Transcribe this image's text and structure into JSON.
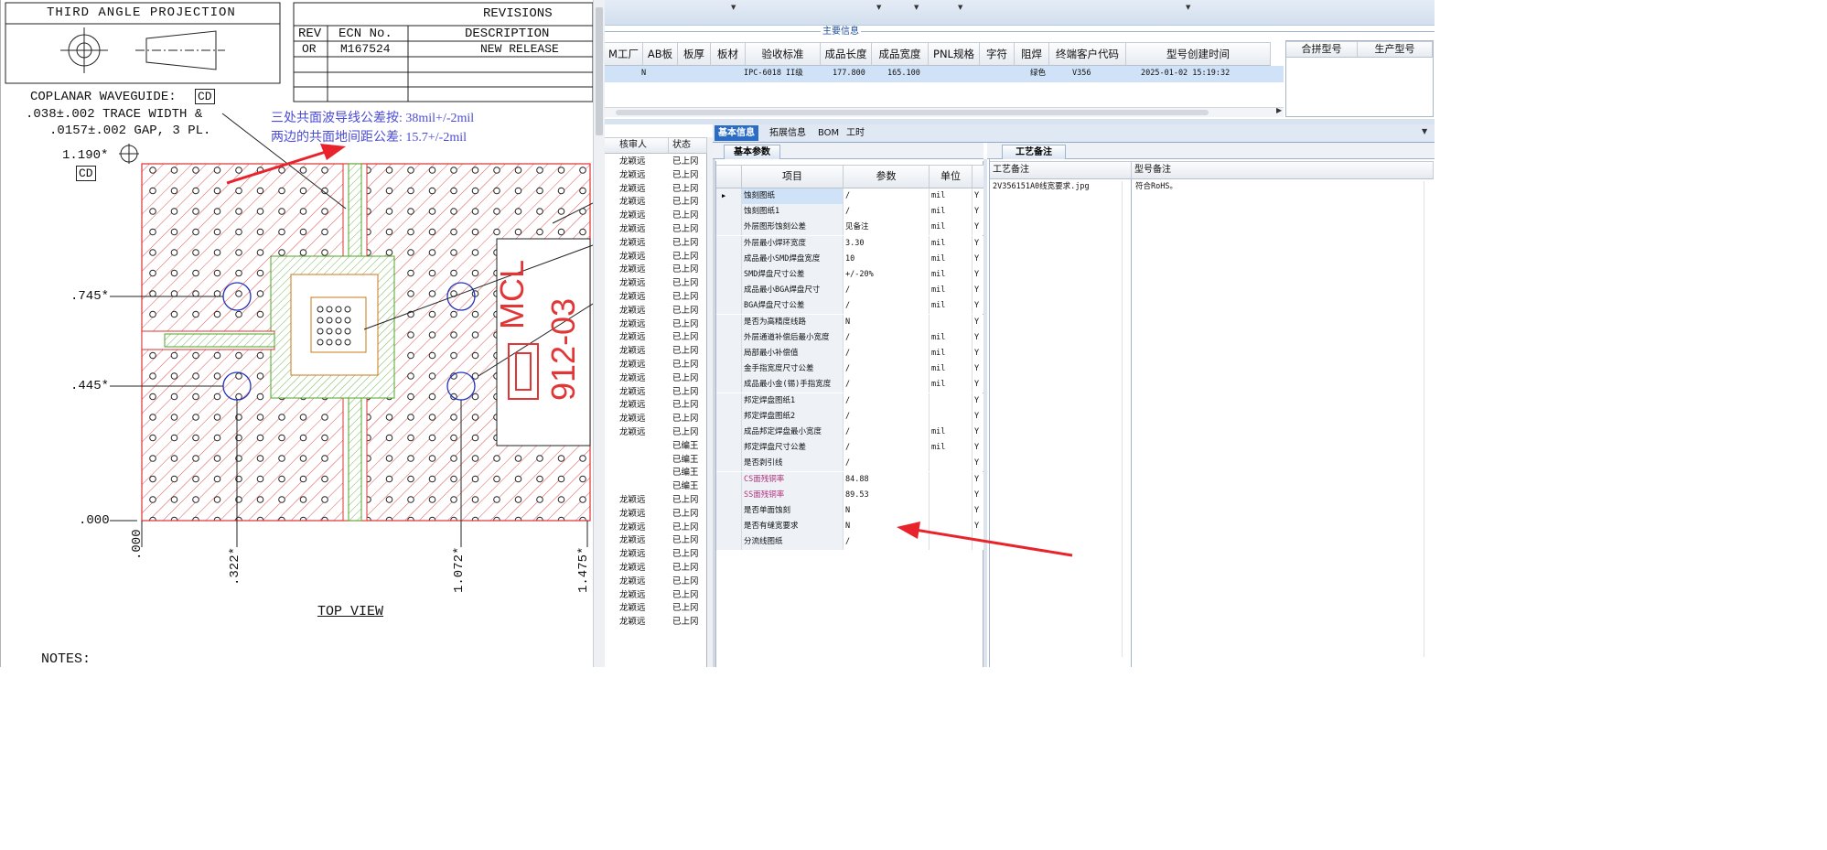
{
  "drawing": {
    "projection": "THIRD ANGLE PROJECTION",
    "revisions_title": "REVISIONS",
    "rev_header": "REV",
    "ecn_header": "ECN No.",
    "desc_header": "DESCRIPTION",
    "rev_value": "OR",
    "ecn_value": "M167524",
    "desc_value": "NEW RELEASE",
    "cpw_line1": "COPLANAR WAVEGUIDE:",
    "cpw_badge": "CD",
    "cpw_line2": ".038±.002 TRACE WIDTH &",
    "cpw_line3": ".0157±.002 GAP, 3 PL.",
    "note_cn1": "三处共面波导线公差按: 38mil+/-2mil",
    "note_cn2": "两边的共面地间距公差: 15.7+/-2mil",
    "dim_1190": "1.190*",
    "dim_cd": "CD",
    "dim_745": ".745*",
    "dim_445": ".445*",
    "dim_000y": ".000",
    "dim_000x": ".000",
    "dim_322": ".322*",
    "dim_1072": "1.072*",
    "dim_1475": "1.475*",
    "mcl": "MCL",
    "part": "912-03",
    "top_view": "TOP VIEW",
    "notes": "NOTES:"
  },
  "app": {
    "main_info_title": "主要信息",
    "main_grid": {
      "columns": [
        "M工厂",
        "AB板",
        "板厚",
        "板材",
        "验收标准",
        "成品长度",
        "成品宽度",
        "PNL规格",
        "字符",
        "阻焊",
        "终端客户代码",
        "型号创建时间"
      ],
      "row": {
        "c1": "N",
        "c2": "IPC-6018 II级",
        "c3": "177.800",
        "c4": "165.100",
        "c5": "绿色",
        "c6": "V356",
        "c7": "2025-01-02 15:19:32"
      }
    },
    "right_grid_columns": [
      "合拼型号",
      "生产型号"
    ],
    "list_headers": [
      "核审人",
      "状态"
    ],
    "list_reviewers": [
      "龙颖远",
      "龙颖远",
      "龙颖远",
      "龙颖远",
      "龙颖远",
      "龙颖远",
      "龙颖远",
      "龙颖远",
      "龙颖远",
      "龙颖远",
      "龙颖远",
      "龙颖远",
      "龙颖远",
      "龙颖远",
      "龙颖远",
      "龙颖远",
      "龙颖远",
      "龙颖远",
      "龙颖远",
      "龙颖远",
      "龙颖远",
      "",
      "",
      "",
      "",
      "龙颖远",
      "龙颖远",
      "龙颖远",
      "龙颖远",
      "龙颖远",
      "龙颖远",
      "龙颖远",
      "龙颖远",
      "龙颖远",
      "龙颖远"
    ],
    "list_status": [
      "已上冈",
      "已上冈",
      "已上冈",
      "已上冈",
      "已上冈",
      "已上冈",
      "已上冈",
      "已上冈",
      "已上冈",
      "已上冈",
      "已上冈",
      "已上冈",
      "已上冈",
      "已上冈",
      "已上冈",
      "已上冈",
      "已上冈",
      "已上冈",
      "已上冈",
      "已上冈",
      "已上冈",
      "已编王",
      "已编王",
      "已编王",
      "已编王",
      "已上冈",
      "已上冈",
      "已上冈",
      "已上冈",
      "已上冈",
      "已上冈",
      "已上冈",
      "已上冈",
      "已上冈",
      "已上冈"
    ],
    "detail_tabs": [
      "基本信息",
      "拓展信息",
      "BOM",
      "工时"
    ],
    "subtab_basic": "基本参数",
    "subtab_craft": "工艺备注",
    "param_headers": [
      "项目",
      "参数",
      "单位"
    ],
    "params": [
      {
        "item": "蚀刻图纸",
        "value": "/",
        "unit": "mil",
        "flag": "Y"
      },
      {
        "item": "蚀刻图纸1",
        "value": "/",
        "unit": "mil",
        "flag": "Y"
      },
      {
        "item": "外层图形蚀刻公差",
        "value": "见备注",
        "unit": "mil",
        "flag": "Y"
      },
      {
        "item": "外层最小焊环宽度",
        "value": "3.30",
        "unit": "mil",
        "flag": "Y"
      },
      {
        "item": "成品最小SMD焊盘宽度",
        "value": "10",
        "unit": "mil",
        "flag": "Y"
      },
      {
        "item": "SMD焊盘尺寸公差",
        "value": "+/-20%",
        "unit": "mil",
        "flag": "Y"
      },
      {
        "item": "成品最小BGA焊盘尺寸",
        "value": "/",
        "unit": "mil",
        "flag": "Y"
      },
      {
        "item": "BGA焊盘尺寸公差",
        "value": "/",
        "unit": "mil",
        "flag": "Y"
      },
      {
        "item": "是否为高精度线路",
        "value": "N",
        "unit": "",
        "flag": "Y"
      },
      {
        "item": "外层通道补偿后最小宽度",
        "value": "/",
        "unit": "mil",
        "flag": "Y"
      },
      {
        "item": "局部最小补偿值",
        "value": "/",
        "unit": "mil",
        "flag": "Y"
      },
      {
        "item": "金手指宽度尺寸公差",
        "value": "/",
        "unit": "mil",
        "flag": "Y"
      },
      {
        "item": "成品最小金(锡)手指宽度",
        "value": "/",
        "unit": "mil",
        "flag": "Y"
      },
      {
        "item": "邦定焊盘图纸1",
        "value": "/",
        "unit": "",
        "flag": "Y"
      },
      {
        "item": "邦定焊盘图纸2",
        "value": "/",
        "unit": "",
        "flag": "Y"
      },
      {
        "item": "成品邦定焊盘最小宽度",
        "value": "/",
        "unit": "mil",
        "flag": "Y"
      },
      {
        "item": "邦定焊盘尺寸公差",
        "value": "/",
        "unit": "mil",
        "flag": "Y"
      },
      {
        "item": "是否剥引线",
        "value": "/",
        "unit": "",
        "flag": "Y"
      },
      {
        "item": "CS面残铜率",
        "value": "84.88",
        "unit": "",
        "flag": "Y"
      },
      {
        "item": "SS面残铜率",
        "value": "89.53",
        "unit": "",
        "flag": "Y"
      },
      {
        "item": "是否单面蚀刻",
        "value": "N",
        "unit": "",
        "flag": "Y"
      },
      {
        "item": "是否有缝宽要求",
        "value": "N",
        "unit": "",
        "flag": "Y"
      },
      {
        "item": "分流线图纸",
        "value": "/",
        "unit": "",
        "flag": ""
      }
    ],
    "craft_headers": [
      "工艺备注",
      "型号备注"
    ],
    "craft_note": "2V356151A0线宽要求.jpg",
    "model_note": "符合RoHS。",
    "colors": {
      "accent": "#2b6cc4",
      "highlight": "#cfe2f7",
      "pink": "#b0337c",
      "arrow": "#e8232c"
    }
  }
}
